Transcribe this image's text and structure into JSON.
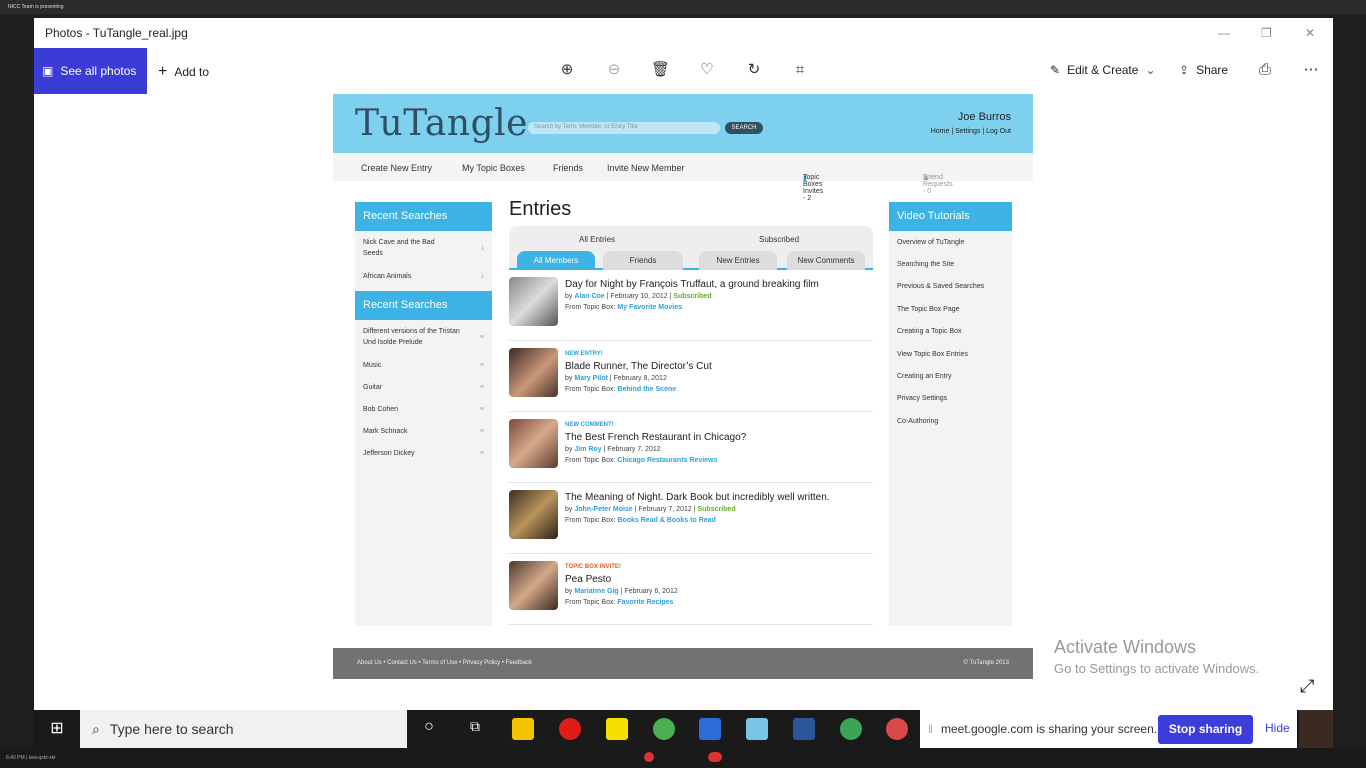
{
  "outer": {
    "banner": "NICC Team is presenting"
  },
  "window": {
    "title": "Photos - TuTangle_real.jpg"
  },
  "toolbar": {
    "see_all": "See all photos",
    "add_to": "Add to",
    "edit_create": "Edit & Create",
    "share": "Share"
  },
  "site": {
    "logo": "TuTangle",
    "search_placeholder": "Search by Term, Member, or Entry Title",
    "search_btn": "SEARCH",
    "user_name": "Joe Burros",
    "user_links": "Home | Settings | Log Out",
    "nav": [
      "Create New Entry",
      "My Topic Boxes",
      "Friends",
      "Invite New Member"
    ],
    "topic_invites": "Topic Boxes Invites - 2",
    "friend_requests": "Friend Requests - 0",
    "left": {
      "h1": "Recent Searches",
      "items1": [
        "Nick Cave and the Bad Seeds",
        "African Animals"
      ],
      "h2": "Recent Searches",
      "items2": [
        "Different versions of the Tristan Und Isolde Prelude",
        "Music",
        "Guitar",
        "Bob Cohen",
        "Mark Schnack",
        "Jefferson Dickey"
      ]
    },
    "entries": {
      "title": "Entries",
      "tab_all": "All Entries",
      "tab_sub": "Subscribed",
      "subtabs": [
        "All Members",
        "Friends",
        "New Entries",
        "New Comments"
      ],
      "list": [
        {
          "tag": "",
          "title": "Day for Night by François Truffaut, a ground breaking film",
          "by": "Alan Coe",
          "date": "| February 10, 2012 |",
          "sub": "Subscribed",
          "box": "My Favorite Movies"
        },
        {
          "tag": "NEW ENTRY!",
          "title": "Blade Runner, The Director’s Cut",
          "by": "Mary Pilot",
          "date": "| February 8, 2012",
          "sub": "",
          "box": "Behind the Scene"
        },
        {
          "tag": "NEW COMMENT!",
          "title": "The Best French Restaurant in Chicago?",
          "by": "Jim Roy",
          "date": "| February 7, 2012",
          "sub": "",
          "box": "Chicago Restaurants Reviews"
        },
        {
          "tag": "",
          "title": "The Meaning of Night. Dark Book but incredibly well written.",
          "by": "John-Peter Moise",
          "date": "| February 7, 2012 |",
          "sub": "Subscribed",
          "box": "Books Read & Books to Read"
        },
        {
          "tag": "TOPIC BOX INVITE!",
          "title": "Pea Pesto",
          "by": "Marianne Gig",
          "date": "| February 6, 2012",
          "sub": "",
          "box": "Favorite Recipes"
        }
      ],
      "by_prefix": "by",
      "box_prefix": "From Topic Box:"
    },
    "right": {
      "h": "Video Tutorials",
      "items": [
        "Overview of TuTangle",
        "Searching the Site",
        "Previous & Saved Searches",
        "The Topic Box Page",
        "Creating a Topic Box",
        "View Topic Box Entries",
        "Creating an Entry",
        "Privacy Settings",
        "Co-Authoring"
      ]
    },
    "footer": {
      "links": "About Us  •  Contact Us  •  Terms of Use  •  Privacy Policy  •  Feedback",
      "copy": "© TuTangle 2013"
    }
  },
  "activate": {
    "line1": "Activate Windows",
    "line2": "Go to Settings to activate Windows."
  },
  "taskbar": {
    "search": "Type here to search",
    "sharing": "meet.google.com is sharing your screen.",
    "stop": "Stop sharing",
    "hide": "Hide"
  },
  "statusbar": {
    "left": "6:40 PM | kea-qxkt-xkr"
  }
}
